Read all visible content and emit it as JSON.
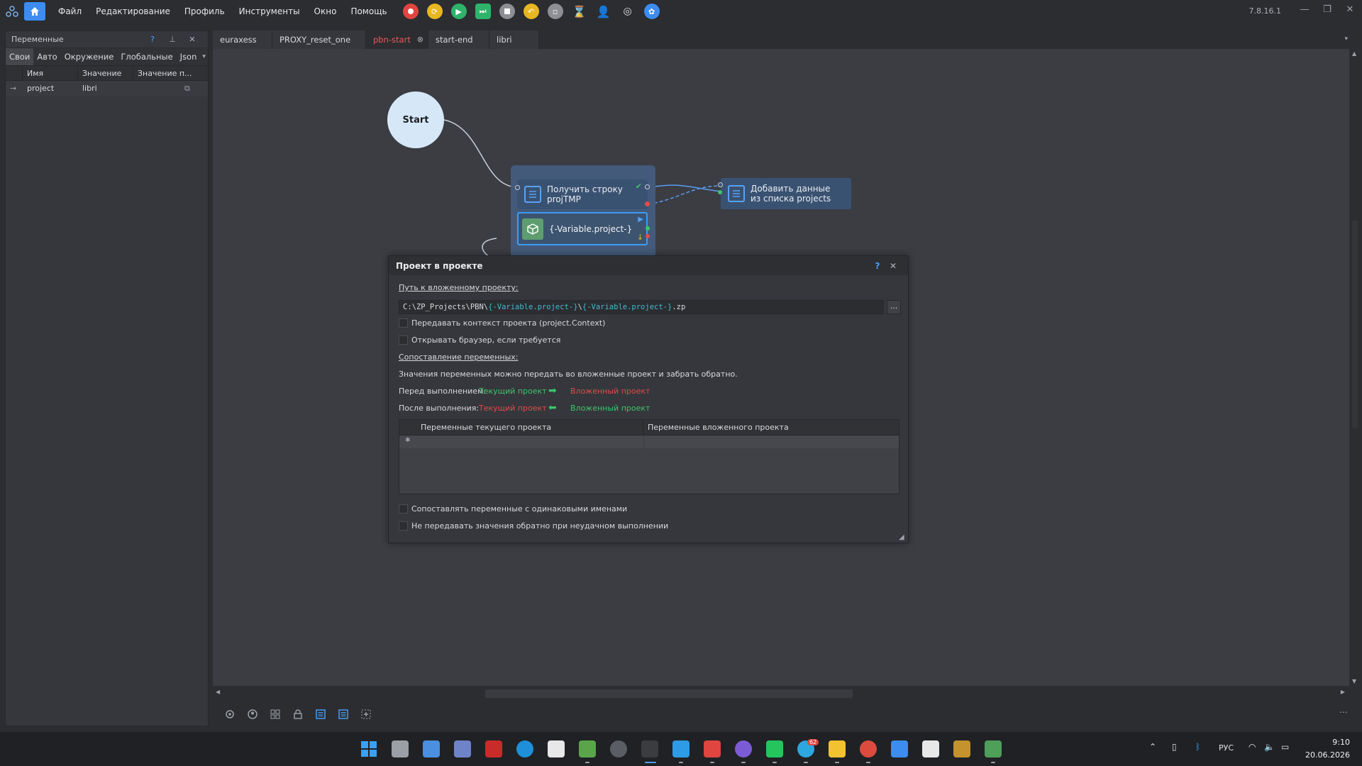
{
  "app": {
    "version": "7.8.16.1",
    "menu": [
      "Файл",
      "Редактирование",
      "Профиль",
      "Инструменты",
      "Окно",
      "Помощь"
    ],
    "colors": {
      "accent": "#3d8cf0",
      "bg": "#2b2d31",
      "canvas": "#3b3d43",
      "node": "#3a5272",
      "active_tab": "#e65c5c"
    }
  },
  "left_panel": {
    "title": "Переменные",
    "help": "?",
    "tabs": [
      "Свои",
      "Авто",
      "Окружение",
      "Глобальные",
      "Json"
    ],
    "columns": [
      "Имя",
      "Значение",
      "Значение п..."
    ],
    "rows": [
      {
        "name": "project",
        "value": "libri"
      }
    ]
  },
  "doc_tabs": [
    {
      "label": "euraxess"
    },
    {
      "label": "PROXY_reset_one"
    },
    {
      "label": "pbn-start"
    },
    {
      "label": "start-end"
    },
    {
      "label": "libri"
    }
  ],
  "nodes": {
    "start": "Start",
    "get_line": "Получить строку projTMP",
    "sub_project": "{-Variable.project-}",
    "add_data": "Добавить данные из списка projects"
  },
  "dialog": {
    "title": "Проект в проекте",
    "help": "?",
    "path_label": "Путь к вложенному проекту:",
    "path_parts": [
      "C:\\ZP_Projects\\PBN\\",
      "{-Variable.project-}",
      "\\",
      "{-Variable.project-}",
      ".zp"
    ],
    "browse": "...",
    "chk_context": "Передавать контекст проекта (project.Context)",
    "chk_browser": "Открывать браузер, если требуется",
    "mapping_label": "Сопоставление переменных:",
    "mapping_desc": "Значения переменных можно передать во вложенные проект и забрать обратно.",
    "before_label": "Перед выполнением:",
    "after_label": "После выполнения:",
    "current_project": "Текущий проект",
    "nested_project": "Вложенный проект",
    "col_current": "Переменные текущего проекта",
    "col_nested": "Переменные вложенного проекта",
    "chk_same_names": "Сопоставлять переменные с одинаковыми именами",
    "chk_no_return": "Не передавать значения обратно при неудачном выполнении"
  },
  "taskbar": {
    "lang": "РУС",
    "time": "9:10",
    "date": "20.06.2026",
    "telegram_badge": "62"
  }
}
